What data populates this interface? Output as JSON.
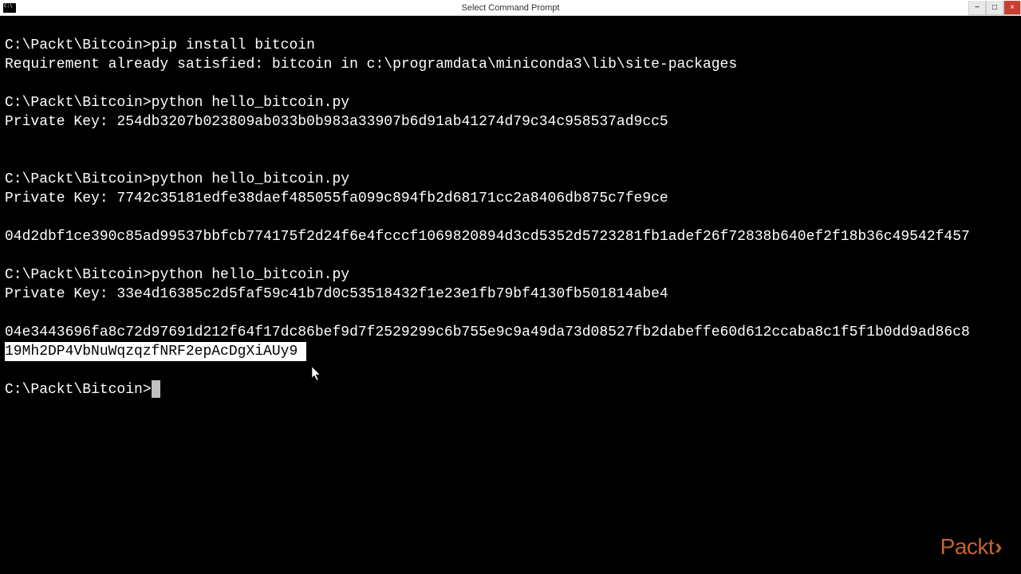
{
  "window": {
    "title": "Select Command Prompt",
    "controls": {
      "minimize": "−",
      "maximize": "□",
      "close": "×"
    }
  },
  "prompt": "C:\\Packt\\Bitcoin>",
  "lines": [
    {
      "prompt": "C:\\Packt\\Bitcoin>",
      "cmd": "pip install bitcoin"
    },
    {
      "text": "Requirement already satisfied: bitcoin in c:\\programdata\\miniconda3\\lib\\site-packages"
    },
    {
      "text": ""
    },
    {
      "prompt": "C:\\Packt\\Bitcoin>",
      "cmd": "python hello_bitcoin.py"
    },
    {
      "text": "Private Key: 254db3207b023809ab033b0b983a33907b6d91ab41274d79c34c958537ad9cc5"
    },
    {
      "text": ""
    },
    {
      "text": ""
    },
    {
      "prompt": "C:\\Packt\\Bitcoin>",
      "cmd": "python hello_bitcoin.py"
    },
    {
      "text": "Private Key: 7742c35181edfe38daef485055fa099c894fb2d68171cc2a8406db875c7fe9ce"
    },
    {
      "text": ""
    },
    {
      "text": "04d2dbf1ce390c85ad99537bbfcb774175f2d24f6e4fcccf1069820894d3cd5352d5723281fb1adef26f72838b640ef2f18b36c49542f457"
    },
    {
      "text": ""
    },
    {
      "prompt": "C:\\Packt\\Bitcoin>",
      "cmd": "python hello_bitcoin.py"
    },
    {
      "text": "Private Key: 33e4d16385c2d5faf59c41b7d0c53518432f1e23e1fb79bf4130fb501814abe4"
    },
    {
      "text": ""
    },
    {
      "text": "04e3443696fa8c72d97691d212f64f17dc86bef9d7f2529299c6b755e9c9a49da73d08527fb2dabeffe60d612ccaba8c1f5f1b0dd9ad86c8"
    },
    {
      "highlighted": "19Mh2DP4VbNuWqzqzfNRF2epAcDgXiAUy9 "
    },
    {
      "text": ""
    },
    {
      "prompt": "C:\\Packt\\Bitcoin>",
      "cursor": true
    }
  ],
  "branding": {
    "logo_text": "Packt",
    "logo_chevron": "›"
  }
}
